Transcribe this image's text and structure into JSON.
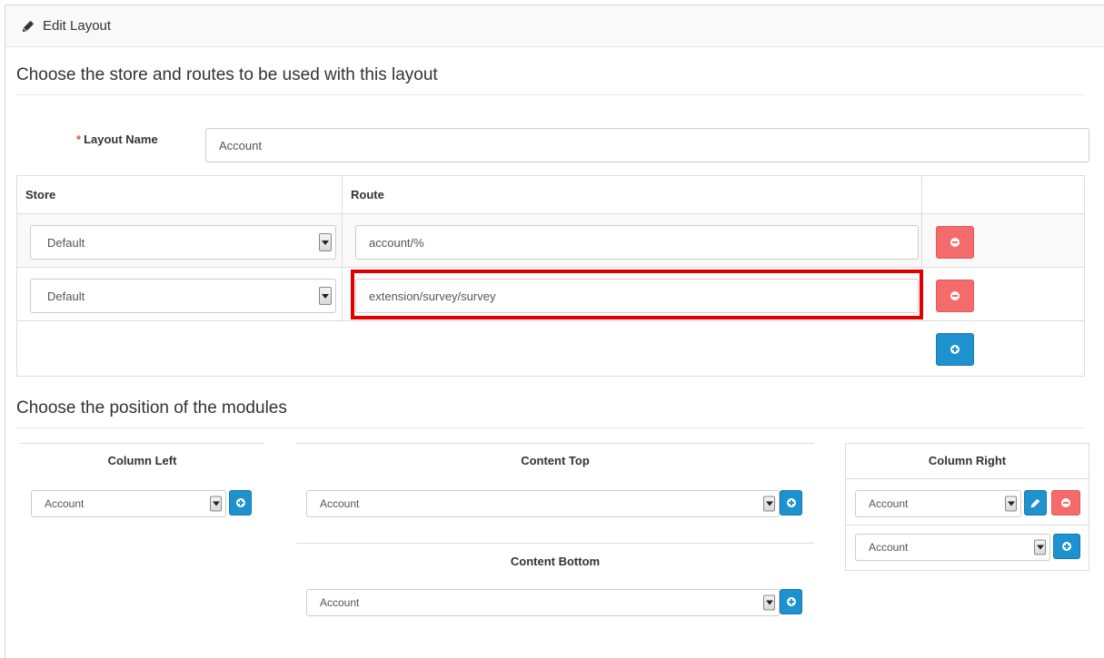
{
  "header": {
    "title": "Edit Layout",
    "icon": "pencil-icon"
  },
  "section_routes": {
    "legend": "Choose the store and routes to be used with this layout"
  },
  "layout_name": {
    "label": "Layout Name",
    "required_mark": "*",
    "value": "Account"
  },
  "routes_table": {
    "columns": [
      "Store",
      "Route",
      ""
    ],
    "rows": [
      {
        "store": "Default",
        "route": "account/%"
      },
      {
        "store": "Default",
        "route": "extension/survey/survey"
      }
    ]
  },
  "section_modules": {
    "legend": "Choose the position of the modules"
  },
  "modules": {
    "column_left": {
      "title": "Column Left",
      "select": "Account"
    },
    "content_top": {
      "title": "Content Top",
      "select": "Account"
    },
    "content_bottom": {
      "title": "Content Bottom",
      "select": "Account"
    },
    "column_right": {
      "title": "Column Right",
      "select_1": "Account",
      "select_2": "Account"
    }
  },
  "colors": {
    "danger": "#f56b6b",
    "primary": "#1e91cf",
    "highlight": "#e00000"
  }
}
